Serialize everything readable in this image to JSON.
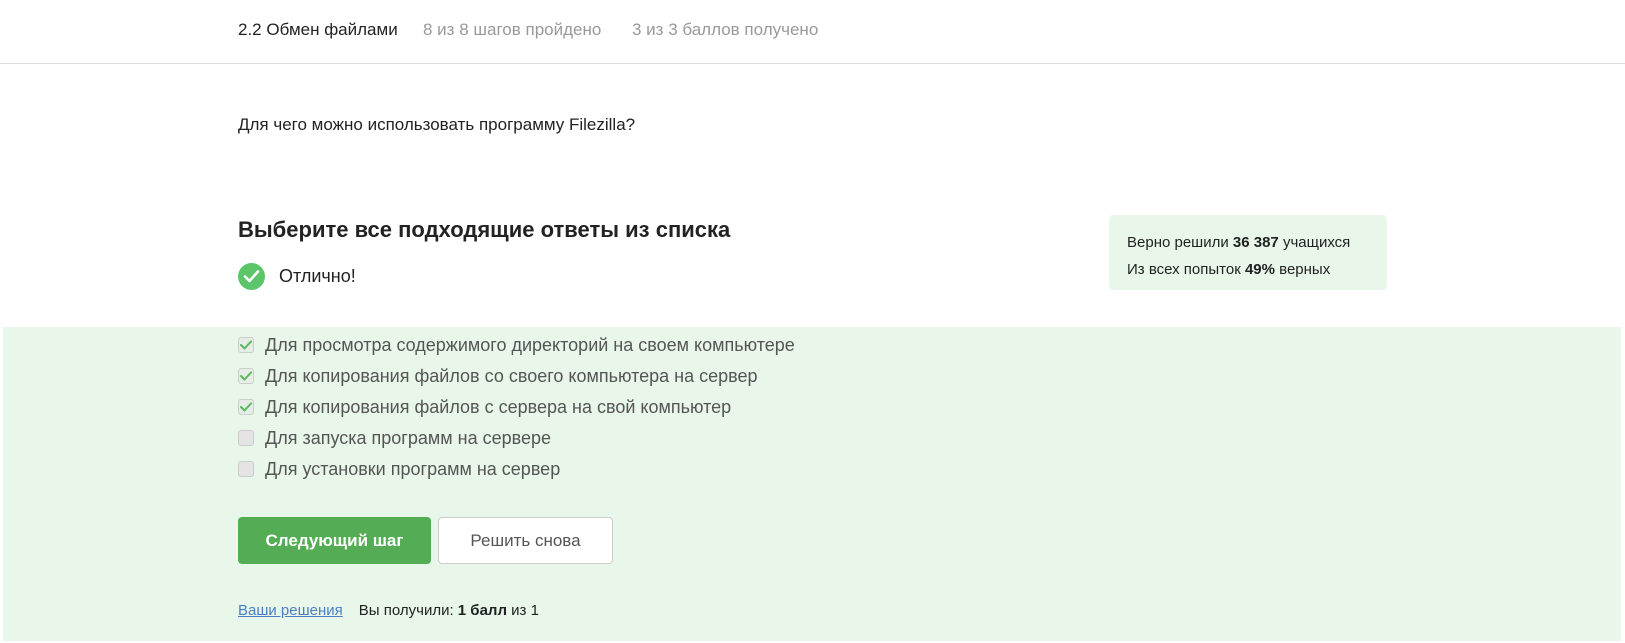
{
  "header": {
    "lesson_title": "2.2 Обмен файлами",
    "steps_progress": "8 из 8 шагов пройдено",
    "score_progress": "3 из 3 баллов  получено"
  },
  "question": {
    "text": "Для чего можно использовать программу Filezilla?",
    "instruction": "Выберите все подходящие ответы из списка",
    "result_text": "Отлично!"
  },
  "stats": {
    "solved_prefix": "Верно решили ",
    "solved_count": "36 387",
    "solved_suffix": " учащихся",
    "attempts_prefix": "Из всех попыток ",
    "attempts_percent": "49%",
    "attempts_suffix": " верных"
  },
  "options": [
    {
      "label": "Для просмотра содержимого директорий на своем компьютере",
      "checked": true
    },
    {
      "label": "Для копирования файлов со своего компьютера на сервер",
      "checked": true
    },
    {
      "label": "Для копирования файлов с сервера на свой компьютер",
      "checked": true
    },
    {
      "label": "Для запуска программ на сервере",
      "checked": false
    },
    {
      "label": "Для установки программ на сервер",
      "checked": false
    }
  ],
  "buttons": {
    "next_label": "Следующий шаг",
    "retry_label": "Решить снова"
  },
  "footer": {
    "solutions_link": "Ваши решения",
    "score_prefix": "Вы получили: ",
    "score_value": "1 балл",
    "score_suffix": " из 1"
  },
  "colors": {
    "accent_green": "#54ad54",
    "success_icon": "#5cc56a",
    "panel_bg": "#e8f7e9",
    "link_blue": "#4a7fc5"
  }
}
